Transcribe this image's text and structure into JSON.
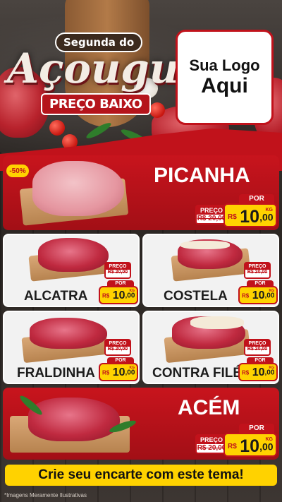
{
  "header": {
    "title_top": "Segunda do",
    "title_main": "Açougue",
    "subtitle": "PREÇO BAIXO",
    "logo_line1": "Sua Logo",
    "logo_line2": "Aqui"
  },
  "discount_badge": "-50%",
  "featured_top": {
    "name": "PICANHA",
    "old_label": "PREÇO",
    "old_price": "R$ 20,00",
    "new_label": "POR",
    "currency": "R$",
    "price_int": "10",
    "price_cents": ",00",
    "unit": "KG"
  },
  "products": [
    {
      "name": "ALCATRA",
      "old_label": "PREÇO",
      "old_price": "R$ 20,00",
      "new_label": "POR",
      "currency": "R$",
      "price_int": "10",
      "price_cents": ",00",
      "unit": "KG"
    },
    {
      "name": "COSTELA",
      "old_label": "PREÇO",
      "old_price": "R$ 20,00",
      "new_label": "POR",
      "currency": "R$",
      "price_int": "10",
      "price_cents": ",00",
      "unit": "KG"
    },
    {
      "name": "FRALDINHA",
      "old_label": "PREÇO",
      "old_price": "R$ 20,00",
      "new_label": "POR",
      "currency": "R$",
      "price_int": "10",
      "price_cents": ",00",
      "unit": "KG"
    },
    {
      "name": "CONTRA FILÉ",
      "old_label": "PREÇO",
      "old_price": "R$ 20,00",
      "new_label": "POR",
      "currency": "R$",
      "price_int": "10",
      "price_cents": ",00",
      "unit": "KG"
    }
  ],
  "featured_bottom": {
    "name": "ACÉM",
    "old_label": "PREÇO",
    "old_price": "R$ 20,00",
    "new_label": "POR",
    "currency": "R$",
    "price_int": "10",
    "price_cents": ",00",
    "unit": "KG"
  },
  "cta": "Crie seu encarte com este tema!",
  "footer_note": "*Imagens Meramente Ilustrativas",
  "colors": {
    "brand_red": "#c1121b",
    "price_yellow": "#ffd200",
    "background_dark": "#2b2623"
  }
}
